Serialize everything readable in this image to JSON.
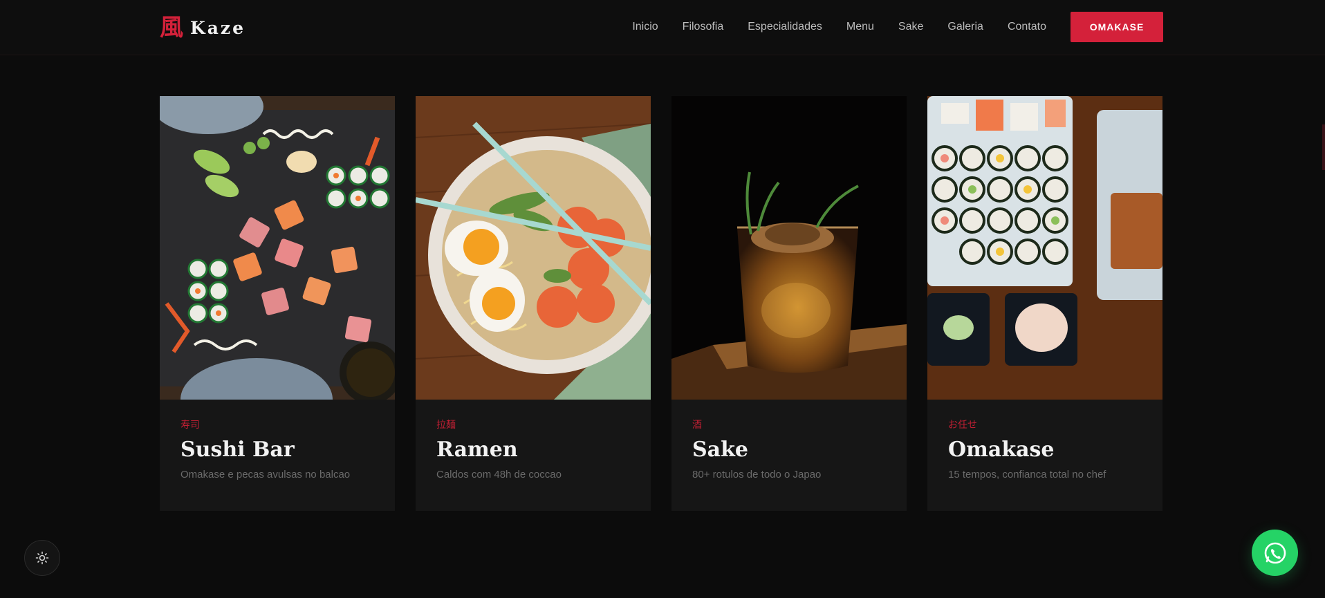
{
  "header": {
    "logo_mark": "風",
    "logo_text": "Kaze",
    "nav": [
      "Inicio",
      "Filosofia",
      "Especialidades",
      "Menu",
      "Sake",
      "Galeria",
      "Contato"
    ],
    "cta_label": "OMAKASE"
  },
  "cards": [
    {
      "jp": "寿司",
      "title": "Sushi Bar",
      "desc": "Omakase e pecas avulsas no balcao",
      "image": "sushi-platter-photo"
    },
    {
      "jp": "拉麺",
      "title": "Ramen",
      "desc": "Caldos com 48h de coccao",
      "image": "ramen-bowl-photo"
    },
    {
      "jp": "酒",
      "title": "Sake",
      "desc": "80+ rotulos de todo o Japao",
      "image": "sake-glass-photo"
    },
    {
      "jp": "お任せ",
      "title": "Omakase",
      "desc": "15 tempos, confianca total no chef",
      "image": "omakase-platters-photo"
    }
  ],
  "floating": {
    "theme_icon": "sun-icon",
    "whatsapp_icon": "whatsapp-icon"
  },
  "colors": {
    "accent": "#d4213a",
    "background": "#0c0c0c",
    "card": "#161616",
    "whatsapp": "#25d366"
  }
}
